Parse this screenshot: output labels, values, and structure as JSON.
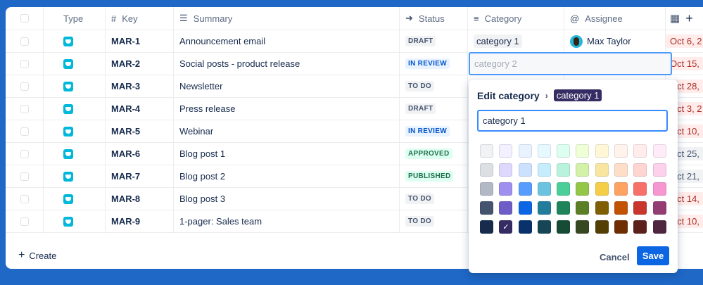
{
  "columns": {
    "type": "Type",
    "key": "Key",
    "summary": "Summary",
    "status": "Status",
    "category": "Category",
    "assignee": "Assignee"
  },
  "header_icons": {
    "key": "hash-icon",
    "summary": "lines-icon",
    "status": "arrow-circle-icon",
    "category": "menu-icon",
    "assignee": "at-icon",
    "date": "calendar-icon",
    "add": "plus-icon"
  },
  "rows": [
    {
      "key": "MAR-1",
      "summary": "Announcement email",
      "status": "DRAFT",
      "status_style": "draft",
      "category": "category 1",
      "assignee": "Max Taylor",
      "date": "Oct 6, 2",
      "date_style": "red"
    },
    {
      "key": "MAR-2",
      "summary": "Social posts - product release",
      "status": "IN REVIEW",
      "status_style": "review",
      "category": "",
      "assignee": "",
      "date": "Oct 15,",
      "date_style": "red"
    },
    {
      "key": "MAR-3",
      "summary": "Newsletter",
      "status": "TO DO",
      "status_style": "todo",
      "category": "",
      "assignee": "",
      "date": "Oct 28,",
      "date_style": "red"
    },
    {
      "key": "MAR-4",
      "summary": "Press release",
      "status": "DRAFT",
      "status_style": "draft",
      "category": "",
      "assignee": "",
      "date": "Oct 3, 2",
      "date_style": "red"
    },
    {
      "key": "MAR-5",
      "summary": "Webinar",
      "status": "IN REVIEW",
      "status_style": "review",
      "category": "",
      "assignee": "",
      "date": "Oct 10,",
      "date_style": "red"
    },
    {
      "key": "MAR-6",
      "summary": "Blog post 1",
      "status": "APPROVED",
      "status_style": "green",
      "category": "",
      "assignee": "",
      "date": "Oct 25,",
      "date_style": "grey"
    },
    {
      "key": "MAR-7",
      "summary": "Blog post 2",
      "status": "PUBLISHED",
      "status_style": "green",
      "category": "",
      "assignee": "",
      "date": "Oct 21,",
      "date_style": "grey"
    },
    {
      "key": "MAR-8",
      "summary": "Blog post 3",
      "status": "TO DO",
      "status_style": "todo",
      "category": "",
      "assignee": "",
      "date": "Oct 14,",
      "date_style": "red"
    },
    {
      "key": "MAR-9",
      "summary": "1-pager: Sales team",
      "status": "TO DO",
      "status_style": "todo",
      "category": "",
      "assignee": "",
      "date": "Oct 10,",
      "date_style": "red"
    }
  ],
  "edit_cell": {
    "placeholder": "category 2"
  },
  "create_label": "Create",
  "popup": {
    "title": "Edit category",
    "tag": "category 1",
    "input_value": "category 1",
    "cancel": "Cancel",
    "save": "Save",
    "selected_color": "#352c63",
    "colors": [
      [
        "#f1f2f4",
        "#f3f0ff",
        "#e9f2ff",
        "#e7f8ff",
        "#dcfff1",
        "#efffd6",
        "#fff7d6",
        "#fff3eb",
        "#ffeceb",
        "#ffecf8"
      ],
      [
        "#dcdfe4",
        "#dfd8fd",
        "#cce0ff",
        "#c6edfb",
        "#baf3db",
        "#d3f1a7",
        "#f8e6a0",
        "#fedec8",
        "#ffd5d2",
        "#fdd0ec"
      ],
      [
        "#b3b9c4",
        "#9f8fef",
        "#579dff",
        "#6cc3e0",
        "#4bce97",
        "#94c748",
        "#f5cd47",
        "#fea362",
        "#f87168",
        "#f797d2"
      ],
      [
        "#44546f",
        "#6e5dc6",
        "#0c66e4",
        "#227d9b",
        "#1f845a",
        "#5b7f24",
        "#7f5f01",
        "#c25100",
        "#c9372c",
        "#943d73"
      ],
      [
        "#172b4d",
        "#352c63",
        "#09326c",
        "#164555",
        "#164b35",
        "#37471f",
        "#533f04",
        "#702e00",
        "#5d1f1a",
        "#50253f"
      ]
    ]
  },
  "colors": {
    "background": "#1f68c6",
    "accent": "#0c66e4",
    "type_icon": "#00b8d9"
  }
}
